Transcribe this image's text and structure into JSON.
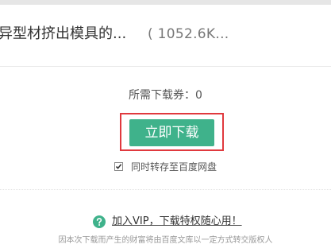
{
  "file": {
    "title": "异型材挤出模具的...",
    "size": "( 1052.6K..."
  },
  "download": {
    "coupon_label": "所需下载券：",
    "coupon_value": "0",
    "button_label": "立即下载",
    "save_to_pan_label": "同时转存至百度网盘",
    "save_to_pan_checked": true
  },
  "vip": {
    "icon": "question-circle-icon",
    "link_text": "加入VIP，下载特权随心用！"
  },
  "notice": "因本次下载而产生的财富将由百度文库以一定方式转交版权人",
  "colors": {
    "accent_green": "#3fb28b",
    "highlight_red": "#e0393e"
  }
}
